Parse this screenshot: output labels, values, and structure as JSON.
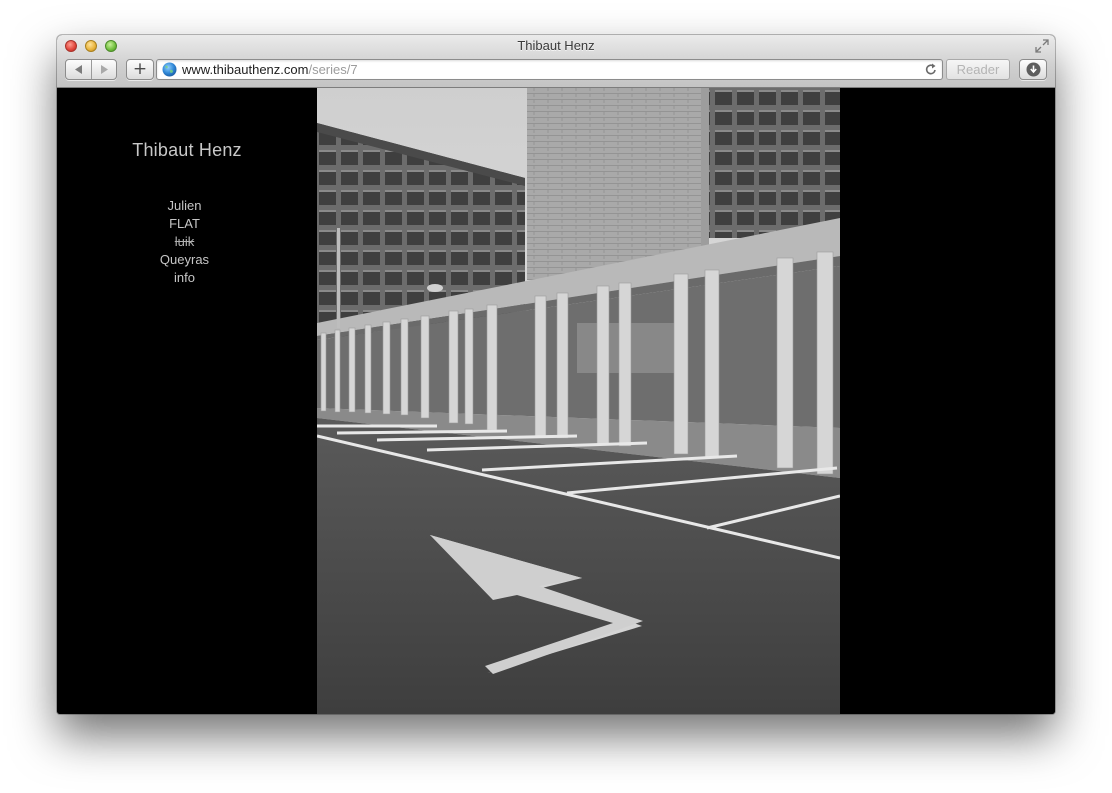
{
  "window": {
    "title": "Thibaut Henz"
  },
  "toolbar": {
    "url_host": "www.thibauthenz.com",
    "url_path": "/series/7",
    "reader_label": "Reader",
    "add_label": "+"
  },
  "site": {
    "title": "Thibaut Henz",
    "nav": [
      "Julien",
      "FLAT",
      "luik",
      "Queyras",
      "info"
    ]
  },
  "photo": {
    "subject": "arrow-parking-lot"
  },
  "colors": {
    "page_bg": "#000000",
    "nav_text": "#c6c6c6"
  }
}
